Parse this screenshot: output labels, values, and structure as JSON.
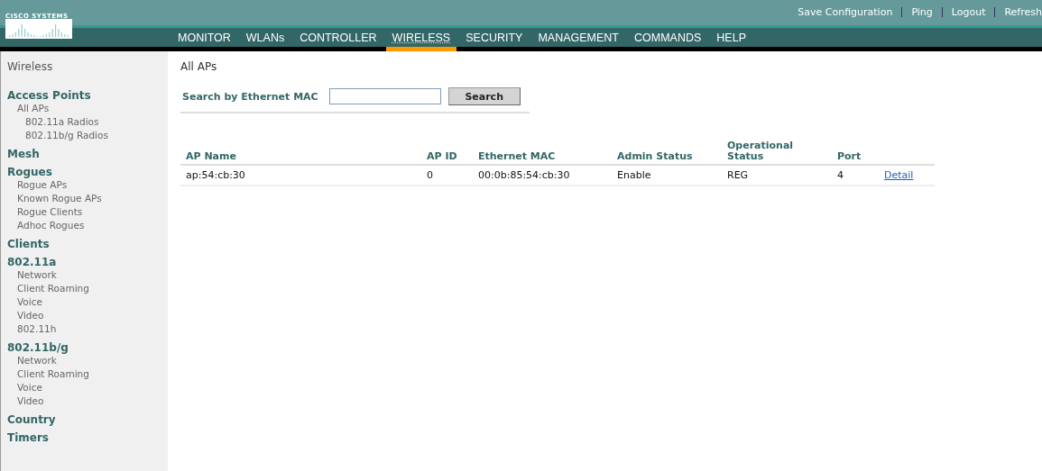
{
  "header": {
    "logo": "CISCO SYSTEMS",
    "links": [
      "Save Configuration",
      "Ping",
      "Logout",
      "Refresh"
    ]
  },
  "nav": [
    {
      "label": "MONITOR",
      "selected": false
    },
    {
      "label": "WLANs",
      "selected": false
    },
    {
      "label": "CONTROLLER",
      "selected": false
    },
    {
      "label": "WIRELESS",
      "selected": true
    },
    {
      "label": "SECURITY",
      "selected": false
    },
    {
      "label": "MANAGEMENT",
      "selected": false
    },
    {
      "label": "COMMANDS",
      "selected": false
    },
    {
      "label": "HELP",
      "selected": false
    }
  ],
  "sidebar": {
    "title": "Wireless",
    "sections": [
      {
        "label": "Access Points",
        "children": [
          {
            "label": "All APs",
            "children": [
              {
                "label": "802.11a Radios"
              },
              {
                "label": "802.11b/g Radios"
              }
            ]
          }
        ]
      },
      {
        "label": "Mesh"
      },
      {
        "label": "Rogues",
        "children": [
          {
            "label": "Rogue APs"
          },
          {
            "label": "Known Rogue APs"
          },
          {
            "label": "Rogue Clients"
          },
          {
            "label": "Adhoc Rogues"
          }
        ]
      },
      {
        "label": "Clients"
      },
      {
        "label": "802.11a",
        "children": [
          {
            "label": "Network"
          },
          {
            "label": "Client Roaming"
          },
          {
            "label": "Voice"
          },
          {
            "label": "Video"
          },
          {
            "label": "802.11h"
          }
        ]
      },
      {
        "label": "802.11b/g",
        "children": [
          {
            "label": "Network"
          },
          {
            "label": "Client Roaming"
          },
          {
            "label": "Voice"
          },
          {
            "label": "Video"
          }
        ]
      },
      {
        "label": "Country"
      },
      {
        "label": "Timers"
      }
    ]
  },
  "page": {
    "title": "All APs",
    "search_label": "Search by Ethernet MAC",
    "search_button": "Search"
  },
  "table": {
    "columns": [
      "AP Name",
      "AP ID",
      "Ethernet MAC",
      "Admin Status",
      "Operational Status",
      "Port"
    ],
    "rows": [
      {
        "cells": [
          "ap:54:cb:30",
          "0",
          "00:0b:85:54:cb:30",
          "Enable",
          "REG",
          "4"
        ],
        "link": "Detail"
      }
    ]
  }
}
